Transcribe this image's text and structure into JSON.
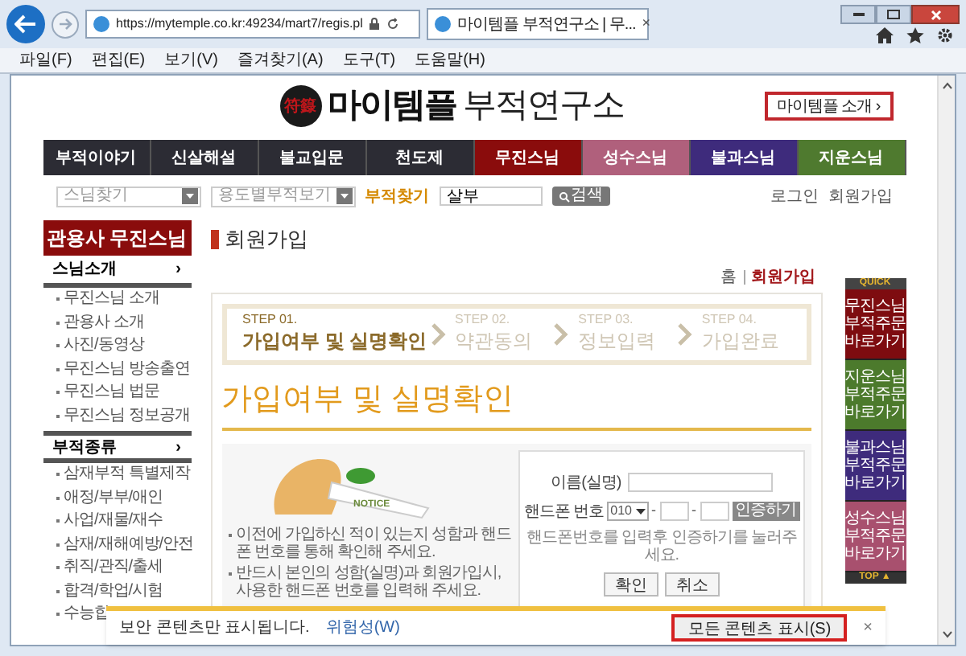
{
  "browser": {
    "address": "https://mytemple.co.kr:49234/mart7/regis.pl",
    "tab_title": "마이템플 부적연구소 | 무...",
    "tab_close": "×",
    "menu": [
      "파일(F)",
      "편집(E)",
      "보기(V)",
      "즐겨찾기(A)",
      "도구(T)",
      "도움말(H)"
    ]
  },
  "header": {
    "logo_mark": "符籙",
    "logo_bold": "마이템플",
    "logo_light": "부적연구소",
    "intro_button": "마이템플 소개",
    "intro_caret": "›"
  },
  "nav": [
    {
      "label": "부적이야기",
      "color": "#2c2c34"
    },
    {
      "label": "신살해설",
      "color": "#2c2c34"
    },
    {
      "label": "불교입문",
      "color": "#2c2c34"
    },
    {
      "label": "천도제",
      "color": "#2c2c34"
    },
    {
      "label": "무진스님",
      "color": "#8a0c0c"
    },
    {
      "label": "성수스님",
      "color": "#b0607c"
    },
    {
      "label": "불과스님",
      "color": "#3e2b7c"
    },
    {
      "label": "지운스님",
      "color": "#4f7a2f"
    }
  ],
  "search": {
    "select_1": "스님찾기",
    "select_2": "용도별부적보기",
    "label": "부적찾기",
    "value": "살부",
    "button": "검색",
    "links": [
      "로그인",
      "회원가입"
    ]
  },
  "sidebar": {
    "title": "관용사 무진스님",
    "sections": [
      {
        "title": "스님소개",
        "caret": "›",
        "items": [
          "무진스님 소개",
          "관용사 소개",
          "사진/동영상",
          "무진스님 방송출연",
          "무진스님 법문",
          "무진스님 정보공개"
        ]
      },
      {
        "title": "부적종류",
        "caret": "›",
        "items": [
          "삼재부적 특별제작",
          "애정/부부/애인",
          "사업/재물/재수",
          "삼재/재해예방/안전",
          "취직/관직/출세",
          "합격/학업/시험",
          "수능합"
        ]
      }
    ]
  },
  "page": {
    "title": "회원가입",
    "breadcrumb": [
      "홈",
      "회원가입"
    ],
    "steps": [
      {
        "step": "STEP 01.",
        "label": "가입여부 및 실명확인",
        "selected": true
      },
      {
        "step": "STEP 02.",
        "label": "약관동의",
        "selected": false
      },
      {
        "step": "STEP 03.",
        "label": "정보입력",
        "selected": false
      },
      {
        "step": "STEP 04.",
        "label": "가입완료",
        "selected": false
      }
    ],
    "heading": "가입여부 및 실명확인",
    "notice_label": "NOTICE",
    "notes": [
      "이전에 가입하신 적이 있는지 성함과 핸드폰 번호를 통해 확인해 주세요.",
      "반드시 본인의 성함(실명)과 회원가입시, 사용한 핸드폰 번호를 입력해 주세요."
    ],
    "form": {
      "name_label": "이름(실명)",
      "phone_label": "핸드폰 번호",
      "phone_prefix": "010",
      "dash": "-",
      "verify_button": "인증하기",
      "hint": "핸드폰번호를 입력후 인증하기를 눌러주세요.",
      "buttons": [
        "확인",
        "취소"
      ]
    }
  },
  "quick": {
    "title": "QUICK",
    "items": [
      {
        "label": "무진스님 부적주문 바로가기",
        "color": "#7e0c10"
      },
      {
        "label": "지운스님 부적주문 바로가기",
        "color": "#4c7a2c"
      },
      {
        "label": "불과스님 부적주문 바로가기",
        "color": "#3e2b7c"
      },
      {
        "label": "성수스님 부적주문 바로가기",
        "color": "#a8506e"
      }
    ],
    "top": "TOP ▲"
  },
  "notification": {
    "message": "보안 콘텐츠만 표시됩니다.",
    "link": "위험성(W)",
    "button": "모든 콘텐츠 표시(S)",
    "close": "×"
  }
}
